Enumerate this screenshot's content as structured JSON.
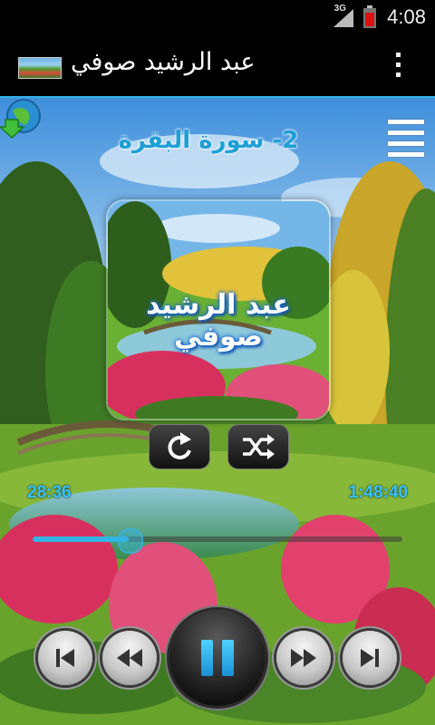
{
  "status_bar": {
    "time": "4:08",
    "network": "3G",
    "icons": [
      "signal-icon",
      "battery-icon"
    ]
  },
  "action_bar": {
    "title": "عبد الرشيد صوفي",
    "icons": [
      "app-icon",
      "overflow-menu-icon"
    ]
  },
  "player": {
    "track_title": "2- سورة البقرة",
    "album_text": "عبد الرشيد صوفي",
    "elapsed": "28:36",
    "duration": "1:48:40",
    "progress": 0.26,
    "icons": [
      "download-icon",
      "menu-icon",
      "repeat-icon",
      "shuffle-icon",
      "previous-icon",
      "rewind-icon",
      "pause-icon",
      "fast-forward-icon",
      "next-icon"
    ],
    "accent_color": "#33b5e5",
    "time_color": "#36c3ff"
  }
}
